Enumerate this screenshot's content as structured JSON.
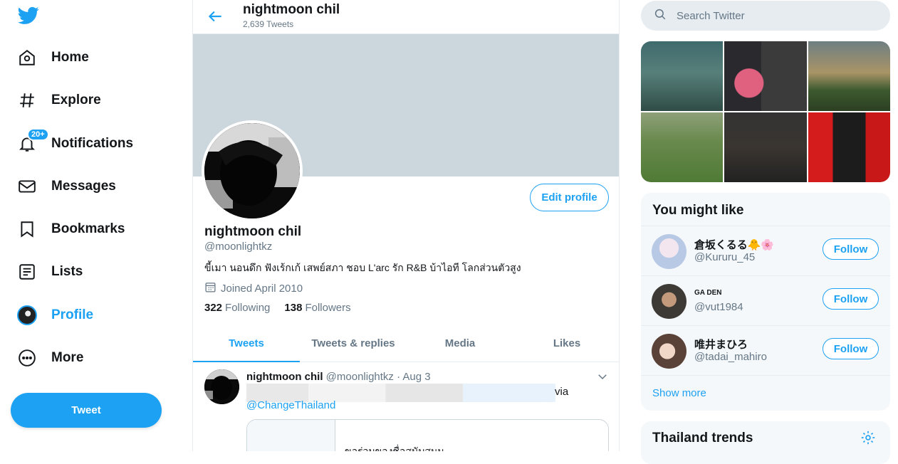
{
  "nav": {
    "items": [
      {
        "label": "Home",
        "icon": "home-icon"
      },
      {
        "label": "Explore",
        "icon": "hashtag-icon"
      },
      {
        "label": "Notifications",
        "icon": "bell-icon"
      },
      {
        "label": "Messages",
        "icon": "envelope-icon"
      },
      {
        "label": "Bookmarks",
        "icon": "bookmark-icon"
      },
      {
        "label": "Lists",
        "icon": "list-icon"
      },
      {
        "label": "Profile",
        "icon": "avatar-icon"
      },
      {
        "label": "More",
        "icon": "more-icon"
      }
    ],
    "notifications_badge": "20+",
    "tweet_button": "Tweet",
    "accent": "#1da1f2"
  },
  "header": {
    "name": "nightmoon chil",
    "tweet_count": "2,639 Tweets"
  },
  "profile": {
    "edit_button": "Edit profile",
    "name": "nightmoon chil",
    "handle": "@moonlightkz",
    "bio": "ขี้เมา นอนดึก ฟังเร้กเก้ เสพย์สภา ชอบ L'arc รัก R&B บ้าไอที โลกส่วนตัวสูง",
    "joined": "Joined April 2010",
    "following_count": "322",
    "following_label": "Following",
    "followers_count": "138",
    "followers_label": "Followers"
  },
  "tabs": [
    {
      "label": "Tweets"
    },
    {
      "label": "Tweets & replies"
    },
    {
      "label": "Media"
    },
    {
      "label": "Likes"
    }
  ],
  "tweet": {
    "name": "nightmoon chil",
    "meta": "@moonlightkz · Aug 3",
    "via": "via",
    "link": "@ChangeThailand",
    "card_text": "ขอร่วมของชื่อสนับสนุน"
  },
  "right": {
    "search_placeholder": "Search Twitter",
    "you_might_like": "You might like",
    "suggestions": [
      {
        "name": "倉坂くるる🐥🌸",
        "handle": "@Kururu_45",
        "follow": "Follow"
      },
      {
        "name": "GA DEN",
        "handle": "@vut1984",
        "follow": "Follow"
      },
      {
        "name": "唯井まひろ",
        "handle": "@tadai_mahiro",
        "follow": "Follow"
      }
    ],
    "show_more": "Show more",
    "trends_title": "Thailand trends"
  }
}
